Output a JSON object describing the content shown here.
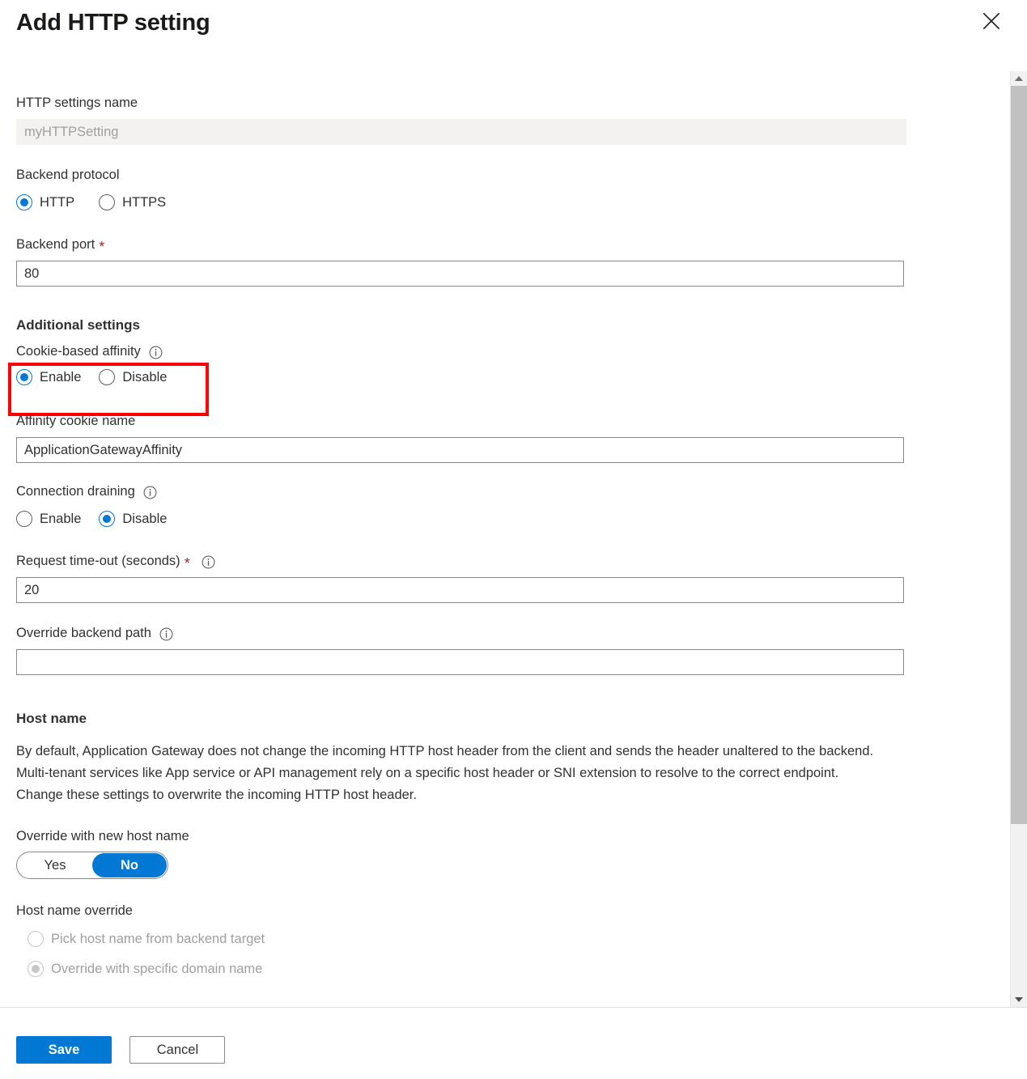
{
  "blade": {
    "title": "Add HTTP setting",
    "close_icon": "close-icon"
  },
  "form": {
    "http_settings_name": {
      "label": "HTTP settings name",
      "value": "myHTTPSetting",
      "disabled": true
    },
    "backend_protocol": {
      "label": "Backend protocol",
      "options": [
        "HTTP",
        "HTTPS"
      ],
      "selected": "HTTP"
    },
    "backend_port": {
      "label": "Backend port",
      "required_marker": "*",
      "value": "80"
    }
  },
  "additional_settings": {
    "heading": "Additional settings",
    "cookie_based_affinity": {
      "label": "Cookie-based affinity",
      "info_icon": "info-icon",
      "options": [
        "Enable",
        "Disable"
      ],
      "selected": "Enable",
      "highlighted": true,
      "highlight_color": "#ff0000"
    },
    "affinity_cookie_name": {
      "label": "Affinity cookie name",
      "value": "ApplicationGatewayAffinity"
    },
    "connection_draining": {
      "label": "Connection draining",
      "info_icon": "info-icon",
      "options": [
        "Enable",
        "Disable"
      ],
      "selected": "Disable"
    },
    "request_timeout": {
      "label": "Request time-out (seconds)",
      "required_marker": "*",
      "info_icon": "info-icon",
      "value": "20"
    },
    "override_backend_path": {
      "label": "Override backend path",
      "info_icon": "info-icon",
      "value": "",
      "placeholder": ""
    }
  },
  "host_name": {
    "heading": "Host name",
    "description": "By default, Application Gateway does not change the incoming HTTP host header from the client and sends the header unaltered to the backend. Multi-tenant services like App service or API management rely on a specific host header or SNI extension to resolve to the correct endpoint. Change these settings to overwrite the incoming HTTP host header.",
    "override_with_new_host_name": {
      "label": "Override with new host name",
      "options": [
        "Yes",
        "No"
      ],
      "selected": "No"
    },
    "host_name_override": {
      "label": "Host name override",
      "options": [
        {
          "label": "Pick host name from backend target",
          "selected": false,
          "disabled": true
        },
        {
          "label": "Override with specific domain name",
          "selected": true,
          "disabled": true
        }
      ]
    }
  },
  "footer": {
    "save_label": "Save",
    "cancel_label": "Cancel"
  },
  "scrollbar": {
    "up_icon": "chevron-up-icon",
    "down_icon": "chevron-down-icon"
  },
  "colors": {
    "accent": "#0078d4",
    "required": "#a4262c",
    "highlight": "#ff0000",
    "disabled_text": "#a19f9d"
  }
}
